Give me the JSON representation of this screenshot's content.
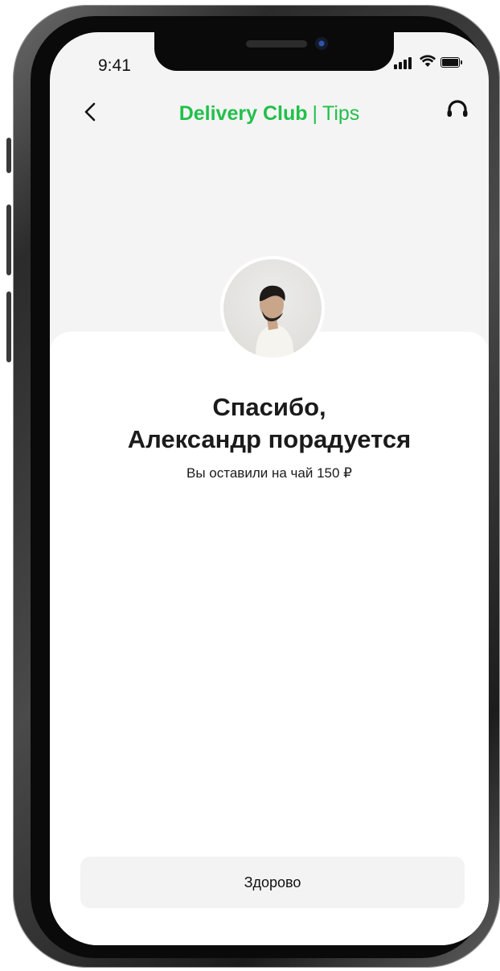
{
  "status_bar": {
    "time": "9:41"
  },
  "header": {
    "brand": "Delivery Club",
    "separator": "|",
    "section": "Tips"
  },
  "main": {
    "title_line1": "Спасибо,",
    "title_line2": "Александр порадуется",
    "subtitle": "Вы оставили на чай 150 ₽"
  },
  "footer": {
    "button_label": "Здорово"
  },
  "icons": {
    "back": "chevron-left-icon",
    "support": "headset-icon",
    "signal": "signal-icon",
    "wifi": "wifi-icon",
    "battery": "battery-icon"
  },
  "colors": {
    "brand_green": "#21c04a",
    "button_bg": "#f3f3f3"
  }
}
